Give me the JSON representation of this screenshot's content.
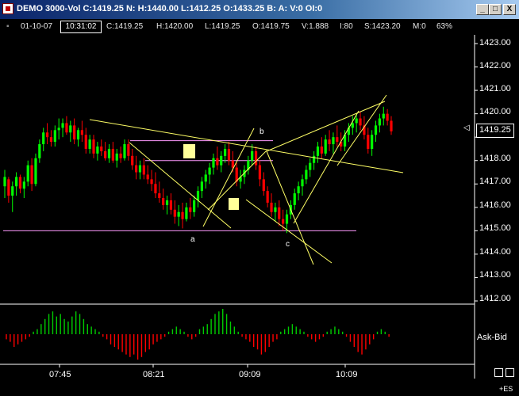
{
  "window": {
    "title": "DEMO 3000-Vol C:1419.25 N: H:1440.00 L:1412.25 O:1433.25 B: A: V:0 OI:0",
    "buttons": {
      "minimize": "_",
      "maximize": "□",
      "close": "X"
    }
  },
  "info_bar": {
    "date": "01-10-07",
    "time": "10:31:02",
    "close": "C:1419.25",
    "high": "H:1420.00",
    "low": "L:1419.25",
    "open": "O:1419.75",
    "volume": "V:1.888",
    "interval": "I:80",
    "s": "S:1423.20",
    "m": "M:0",
    "pct": "63%"
  },
  "price_axis": {
    "labels": [
      "1423.00",
      "1422.00",
      "1421.00",
      "1420.00",
      "1419.00",
      "1418.00",
      "1417.00",
      "1416.00",
      "1415.00",
      "1414.00",
      "1413.00",
      "1412.00"
    ],
    "current": "1419.25"
  },
  "time_axis": {
    "labels": [
      "07:45",
      "08:21",
      "09:09",
      "10:09"
    ]
  },
  "annotations": {
    "a": "a",
    "b": "b",
    "c": "c"
  },
  "indicator": {
    "label": "Ask-Bid"
  },
  "symbol": "+ES",
  "colors": {
    "up": "#00ff00",
    "down": "#ff0000",
    "background": "#000000"
  },
  "chart_data": {
    "type": "candlestick",
    "ylim": [
      1412.0,
      1423.3
    ],
    "x_ticks": [
      "07:45",
      "08:21",
      "09:09",
      "10:09"
    ],
    "ohlc_approx": [
      [
        1416.9,
        1417.6,
        1416.4,
        1417.3
      ],
      [
        1417.2,
        1417.3,
        1416.2,
        1416.5
      ],
      [
        1416.5,
        1417.1,
        1415.8,
        1416.9
      ],
      [
        1416.9,
        1417.5,
        1416.5,
        1417.3
      ],
      [
        1417.3,
        1417.4,
        1416.6,
        1416.8
      ],
      [
        1416.8,
        1417.3,
        1416.4,
        1417.1
      ],
      [
        1417.1,
        1418.0,
        1416.9,
        1417.8
      ],
      [
        1417.8,
        1418.1,
        1416.7,
        1417.0
      ],
      [
        1417.0,
        1418.3,
        1416.9,
        1418.1
      ],
      [
        1418.1,
        1418.9,
        1417.9,
        1418.7
      ],
      [
        1418.7,
        1419.4,
        1418.4,
        1419.2
      ],
      [
        1419.2,
        1419.6,
        1418.7,
        1419.0
      ],
      [
        1419.0,
        1419.3,
        1418.6,
        1418.8
      ],
      [
        1418.8,
        1419.5,
        1418.6,
        1419.3
      ],
      [
        1419.3,
        1419.8,
        1418.9,
        1419.4
      ],
      [
        1419.4,
        1419.8,
        1419.0,
        1419.6
      ],
      [
        1419.6,
        1419.9,
        1419.1,
        1419.2
      ],
      [
        1419.2,
        1419.7,
        1418.8,
        1419.5
      ],
      [
        1419.5,
        1419.8,
        1418.7,
        1418.9
      ],
      [
        1418.9,
        1419.4,
        1418.6,
        1419.3
      ],
      [
        1419.3,
        1419.7,
        1418.8,
        1419.1
      ],
      [
        1419.1,
        1419.4,
        1418.3,
        1418.5
      ],
      [
        1418.5,
        1419.1,
        1418.3,
        1418.9
      ],
      [
        1418.9,
        1419.1,
        1418.1,
        1418.3
      ],
      [
        1418.3,
        1418.8,
        1418.0,
        1418.6
      ],
      [
        1418.6,
        1418.9,
        1418.2,
        1418.4
      ],
      [
        1418.4,
        1418.8,
        1418.0,
        1418.1
      ],
      [
        1418.1,
        1418.7,
        1417.9,
        1418.5
      ],
      [
        1418.5,
        1418.8,
        1417.9,
        1418.0
      ],
      [
        1418.0,
        1418.5,
        1417.7,
        1418.3
      ],
      [
        1418.3,
        1418.6,
        1417.9,
        1418.1
      ],
      [
        1418.1,
        1418.9,
        1418.0,
        1418.7
      ],
      [
        1418.7,
        1418.9,
        1418.0,
        1418.2
      ],
      [
        1418.2,
        1418.5,
        1417.6,
        1417.8
      ],
      [
        1417.8,
        1418.2,
        1417.2,
        1417.5
      ],
      [
        1417.5,
        1418.0,
        1417.2,
        1417.8
      ],
      [
        1417.8,
        1418.1,
        1417.2,
        1417.4
      ],
      [
        1417.4,
        1417.8,
        1417.0,
        1417.2
      ],
      [
        1417.2,
        1417.6,
        1416.7,
        1417.0
      ],
      [
        1417.0,
        1417.5,
        1416.4,
        1416.6
      ],
      [
        1416.6,
        1417.1,
        1416.2,
        1416.4
      ],
      [
        1416.4,
        1416.8,
        1415.9,
        1416.1
      ],
      [
        1416.1,
        1416.5,
        1415.7,
        1416.3
      ],
      [
        1416.3,
        1416.6,
        1415.7,
        1415.9
      ],
      [
        1415.9,
        1416.3,
        1415.3,
        1415.6
      ],
      [
        1415.6,
        1416.1,
        1415.2,
        1415.8
      ],
      [
        1415.8,
        1416.2,
        1415.1,
        1415.5
      ],
      [
        1415.5,
        1416.2,
        1415.4,
        1416.0
      ],
      [
        1416.0,
        1416.4,
        1415.5,
        1415.8
      ],
      [
        1415.8,
        1416.5,
        1415.6,
        1416.3
      ],
      [
        1416.3,
        1416.9,
        1416.0,
        1416.7
      ],
      [
        1416.7,
        1417.3,
        1416.4,
        1417.1
      ],
      [
        1417.1,
        1417.6,
        1416.8,
        1417.4
      ],
      [
        1417.4,
        1417.9,
        1417.0,
        1417.7
      ],
      [
        1417.7,
        1418.3,
        1417.4,
        1418.1
      ],
      [
        1418.1,
        1418.6,
        1417.6,
        1417.8
      ],
      [
        1417.8,
        1418.4,
        1417.5,
        1418.2
      ],
      [
        1418.2,
        1418.7,
        1417.9,
        1418.5
      ],
      [
        1418.5,
        1418.8,
        1417.8,
        1418.0
      ],
      [
        1418.0,
        1418.4,
        1417.5,
        1417.7
      ],
      [
        1417.7,
        1417.9,
        1416.9,
        1417.1
      ],
      [
        1417.1,
        1417.6,
        1416.8,
        1417.3
      ],
      [
        1417.3,
        1417.8,
        1417.0,
        1417.6
      ],
      [
        1417.6,
        1418.2,
        1417.4,
        1418.0
      ],
      [
        1418.0,
        1418.7,
        1417.8,
        1418.4
      ],
      [
        1418.4,
        1418.6,
        1417.6,
        1417.8
      ],
      [
        1417.8,
        1418.0,
        1416.9,
        1417.2
      ],
      [
        1417.2,
        1417.5,
        1416.5,
        1416.7
      ],
      [
        1416.7,
        1416.9,
        1416.0,
        1416.2
      ],
      [
        1416.2,
        1416.6,
        1415.6,
        1415.8
      ],
      [
        1415.8,
        1416.2,
        1415.4,
        1416.0
      ],
      [
        1416.0,
        1416.3,
        1415.2,
        1415.5
      ],
      [
        1415.5,
        1415.9,
        1415.0,
        1415.3
      ],
      [
        1415.3,
        1415.9,
        1414.9,
        1415.7
      ],
      [
        1415.7,
        1416.3,
        1415.5,
        1416.1
      ],
      [
        1416.1,
        1416.8,
        1415.9,
        1416.6
      ],
      [
        1416.6,
        1417.1,
        1416.3,
        1416.9
      ],
      [
        1416.9,
        1417.4,
        1416.5,
        1417.2
      ],
      [
        1417.2,
        1417.8,
        1417.0,
        1417.6
      ],
      [
        1417.6,
        1418.1,
        1417.3,
        1417.9
      ],
      [
        1417.9,
        1418.4,
        1417.6,
        1418.2
      ],
      [
        1418.2,
        1418.8,
        1417.9,
        1418.6
      ],
      [
        1418.6,
        1419.0,
        1418.1,
        1418.3
      ],
      [
        1418.3,
        1419.1,
        1418.2,
        1418.9
      ],
      [
        1418.9,
        1419.3,
        1418.4,
        1418.7
      ],
      [
        1418.7,
        1419.2,
        1418.3,
        1419.0
      ],
      [
        1419.0,
        1419.5,
        1418.6,
        1418.8
      ],
      [
        1418.8,
        1419.2,
        1418.4,
        1418.6
      ],
      [
        1418.6,
        1419.3,
        1418.4,
        1419.1
      ],
      [
        1419.1,
        1419.6,
        1418.8,
        1419.4
      ],
      [
        1419.4,
        1419.9,
        1419.1,
        1419.6
      ],
      [
        1419.6,
        1420.0,
        1419.2,
        1419.8
      ],
      [
        1419.8,
        1420.1,
        1419.3,
        1419.5
      ],
      [
        1419.5,
        1419.9,
        1418.9,
        1419.1
      ],
      [
        1419.1,
        1419.4,
        1418.3,
        1418.5
      ],
      [
        1418.5,
        1419.3,
        1418.2,
        1419.1
      ],
      [
        1419.1,
        1419.7,
        1418.8,
        1419.5
      ],
      [
        1419.5,
        1420.0,
        1419.2,
        1419.8
      ],
      [
        1419.8,
        1420.3,
        1419.5,
        1420.0
      ],
      [
        1420.0,
        1420.2,
        1419.5,
        1419.7
      ],
      [
        1419.7,
        1419.9,
        1419.1,
        1419.25
      ]
    ],
    "horizontal_lines": [
      1418.85,
      1418.0,
      1415.0
    ],
    "ask_bid_histogram": [
      -2,
      -3,
      -5,
      -4,
      -3,
      -2,
      -1,
      1,
      2,
      4,
      6,
      8,
      9,
      7,
      8,
      6,
      5,
      7,
      9,
      8,
      6,
      4,
      3,
      2,
      1,
      -1,
      -2,
      -4,
      -5,
      -6,
      -7,
      -8,
      -9,
      -8,
      -10,
      -9,
      -7,
      -6,
      -4,
      -3,
      -2,
      -1,
      1,
      2,
      3,
      2,
      1,
      -1,
      -2,
      -1,
      2,
      3,
      4,
      6,
      8,
      9,
      10,
      8,
      5,
      3,
      1,
      -1,
      -2,
      -3,
      -5,
      -6,
      -8,
      -7,
      -5,
      -3,
      -2,
      1,
      2,
      3,
      4,
      3,
      2,
      1,
      -1,
      -2,
      -3,
      -2,
      -1,
      1,
      2,
      3,
      2,
      1,
      -1,
      -3,
      -5,
      -7,
      -8,
      -6,
      -4,
      -2,
      1,
      2,
      1,
      -1
    ]
  }
}
